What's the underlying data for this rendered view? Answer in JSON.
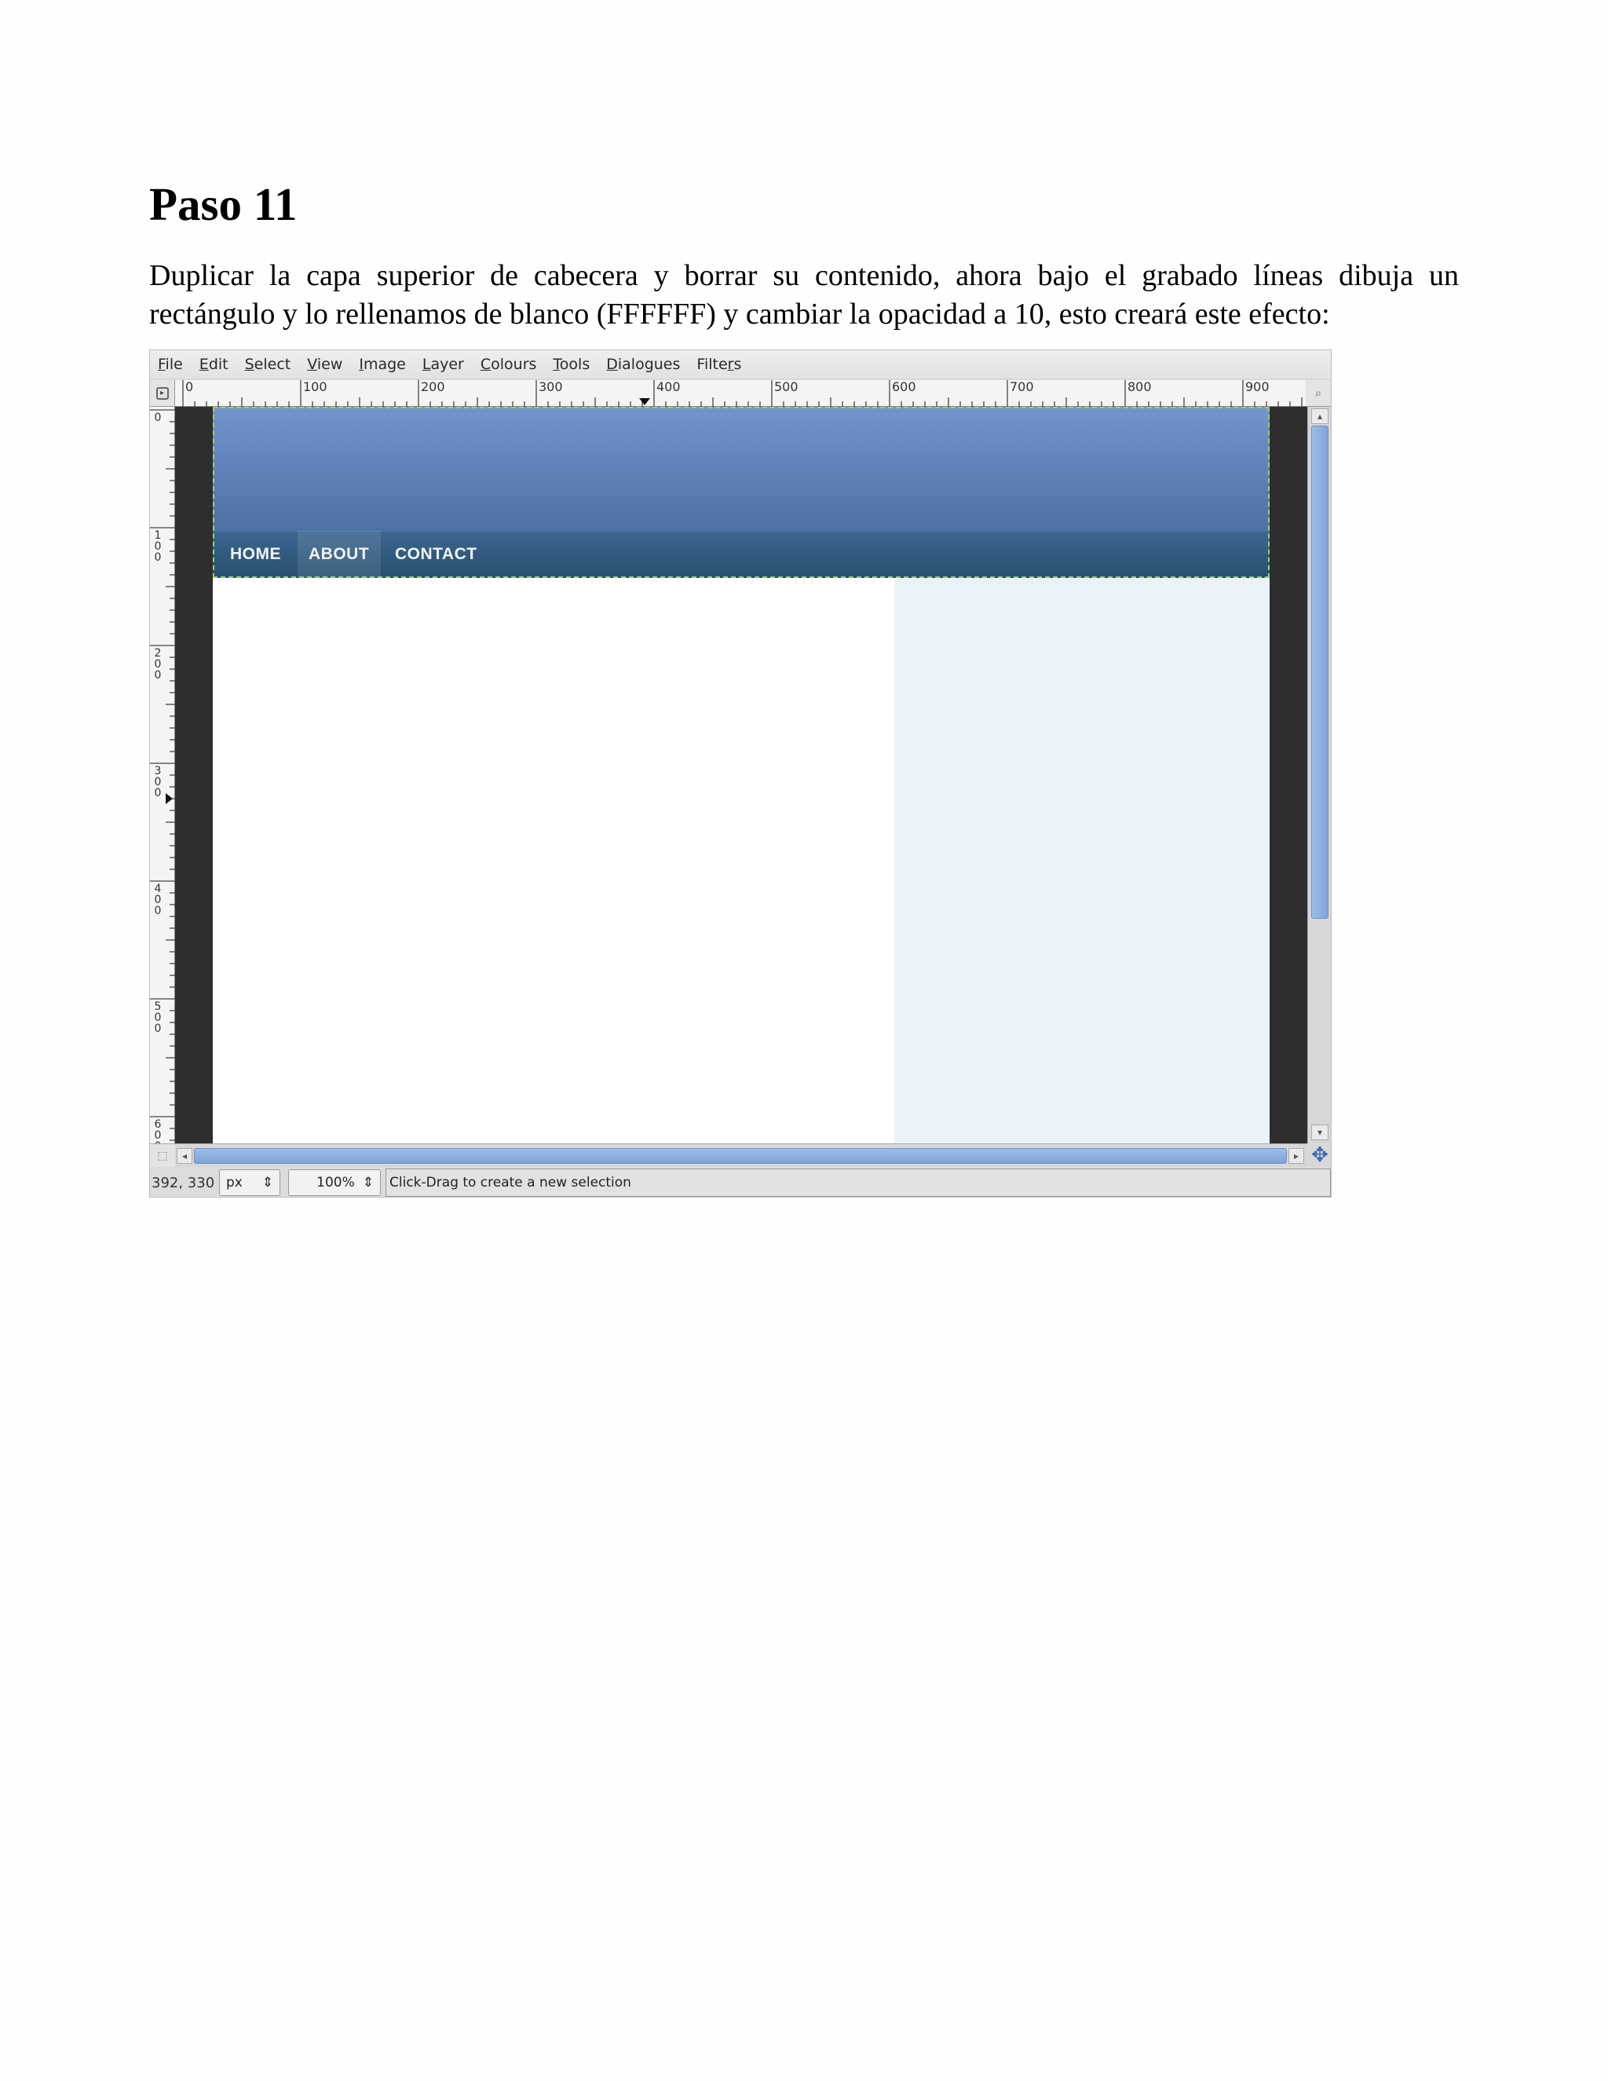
{
  "document": {
    "title": "Paso 11",
    "paragraph": "Duplicar la capa superior de cabecera y borrar su contenido, ahora bajo el grabado líneas dibuja un rectángulo y lo rellenamos de blanco (FFFFFF) y cambiar la opacidad a 10, esto creará este efecto:"
  },
  "gimp": {
    "menu": [
      {
        "mn": "F",
        "rest": "ile"
      },
      {
        "mn": "E",
        "rest": "dit"
      },
      {
        "mn": "S",
        "rest": "elect"
      },
      {
        "mn": "V",
        "rest": "iew"
      },
      {
        "mn": "I",
        "rest": "mage"
      },
      {
        "mn": "L",
        "rest": "ayer"
      },
      {
        "mn": "C",
        "rest": "olours"
      },
      {
        "mn": "T",
        "rest": "ools"
      },
      {
        "mn": "D",
        "rest": "ialogues"
      },
      {
        "pre": "Filte",
        "mn": "r",
        "rest": "s"
      }
    ],
    "hruler_labels": [
      "0",
      "100",
      "200",
      "300",
      "400",
      "500",
      "600",
      "700",
      "800",
      "900"
    ],
    "vruler_labels": [
      "0",
      "100",
      "200",
      "300",
      "400",
      "500",
      "600"
    ],
    "canvas": {
      "nav": [
        "HOME",
        "ABOUT",
        "CONTACT"
      ]
    },
    "status": {
      "coords": "392, 330",
      "unit": "px",
      "zoom": "100%",
      "message": "Click-Drag to create a new selection"
    }
  }
}
